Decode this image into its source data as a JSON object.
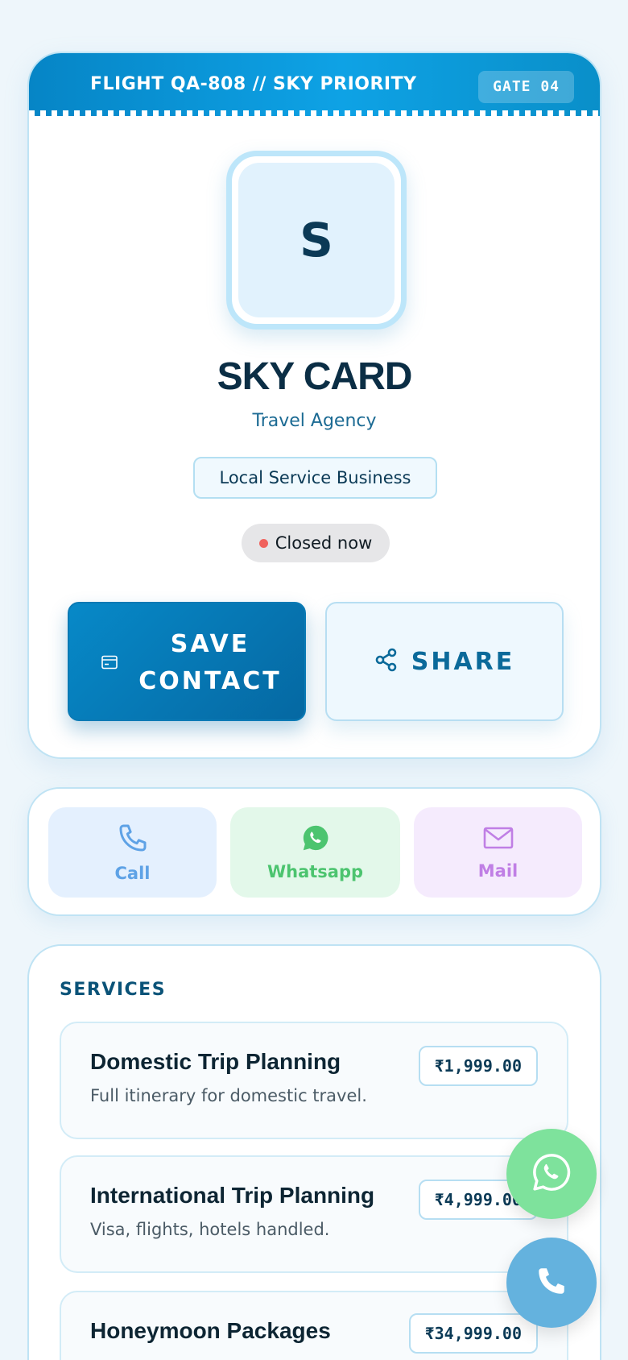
{
  "header": {
    "flight_title": "FLIGHT QA-808 // SKY PRIORITY",
    "gate": "GATE 04"
  },
  "profile": {
    "avatar_initial": "S",
    "name": "SKY CARD",
    "category": "Travel Agency",
    "business_type": "Local Service Business",
    "status": "Closed now",
    "status_color": "#f0625d"
  },
  "actions": {
    "save_line1": "SAVE",
    "save_line2": "CONTACT",
    "share_label": "SHARE"
  },
  "contact": {
    "call_label": "Call",
    "whatsapp_label": "Whatsapp",
    "mail_label": "Mail"
  },
  "services": {
    "title": "SERVICES",
    "items": [
      {
        "name": "Domestic Trip Planning",
        "description": "Full itinerary for domestic travel.",
        "price": "₹1,999.00"
      },
      {
        "name": "International Trip Planning",
        "description": "Visa, flights, hotels handled.",
        "price": "₹4,999.00"
      },
      {
        "name": "Honeymoon Packages",
        "description": "",
        "price": "₹34,999.00"
      }
    ]
  },
  "colors": {
    "brand_blue": "#0789c8",
    "whatsapp_green": "#4cc46f",
    "call_blue": "#5ea2e6",
    "mail_purple": "#c07fe5"
  },
  "icons": [
    "card-icon",
    "share-icon",
    "phone-icon",
    "whatsapp-icon",
    "mail-icon"
  ]
}
